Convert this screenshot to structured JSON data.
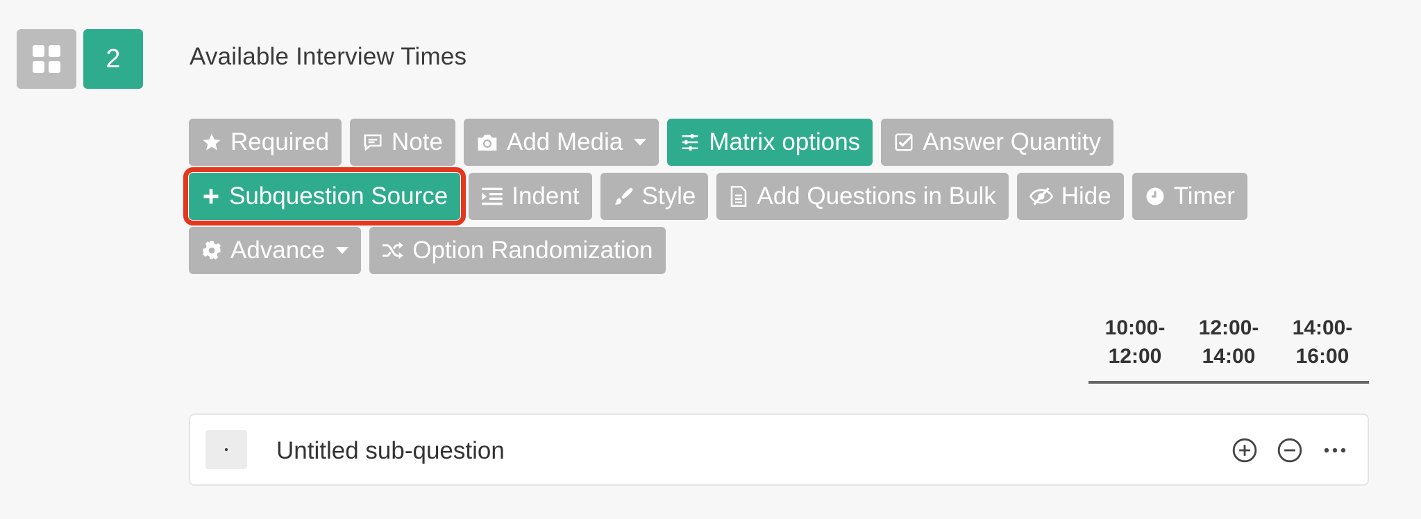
{
  "question": {
    "number": "2",
    "title": "Available Interview Times"
  },
  "toolbar": {
    "row1": [
      {
        "label": "Required",
        "icon": "star-icon"
      },
      {
        "label": "Note",
        "icon": "comment-icon"
      },
      {
        "label": "Add Media",
        "icon": "camera-icon",
        "dropdown": true
      },
      {
        "label": "Matrix options",
        "icon": "sliders-icon",
        "active": true
      },
      {
        "label": "Answer Quantity",
        "icon": "checkbox-icon"
      }
    ],
    "row2": [
      {
        "label": "Subquestion Source",
        "icon": "plus-icon",
        "active": true,
        "highlighted": true
      },
      {
        "label": "Indent",
        "icon": "indent-icon"
      },
      {
        "label": "Style",
        "icon": "brush-icon"
      },
      {
        "label": "Add Questions in Bulk",
        "icon": "document-icon"
      },
      {
        "label": "Hide",
        "icon": "eye-slash-icon"
      },
      {
        "label": "Timer",
        "icon": "clock-icon"
      }
    ],
    "row3": [
      {
        "label": "Advance",
        "icon": "gear-icon",
        "dropdown": true
      },
      {
        "label": "Option Randomization",
        "icon": "shuffle-icon"
      }
    ]
  },
  "matrix": {
    "columns": [
      {
        "line1": "10:00-",
        "line2": "12:00"
      },
      {
        "line1": "12:00-",
        "line2": "14:00"
      },
      {
        "line1": "14:00-",
        "line2": "16:00"
      }
    ],
    "subquestion": {
      "label": "Untitled sub-question"
    }
  },
  "colors": {
    "accent": "#2fac8e",
    "button_gray": "#b5b4b5",
    "highlight": "#e5361e"
  }
}
